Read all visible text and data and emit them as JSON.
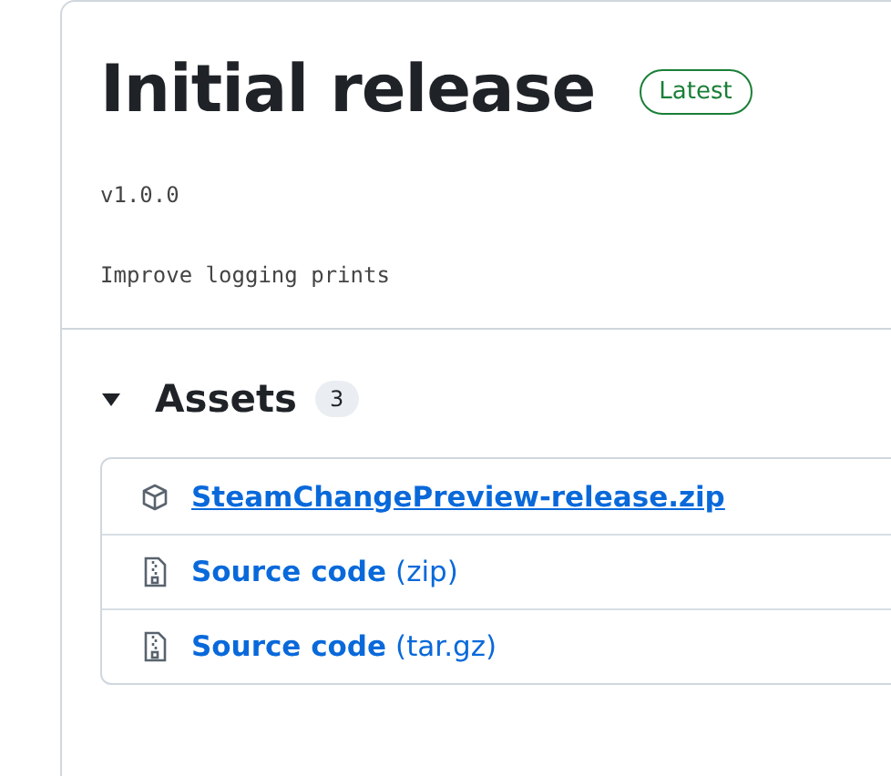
{
  "release": {
    "title": "Initial release",
    "badge": "Latest",
    "tag": "v1.0.0",
    "notes": "Improve logging prints"
  },
  "assets": {
    "heading": "Assets",
    "count": "3",
    "expanded": true,
    "items": [
      {
        "kind": "package",
        "name": "SteamChangePreview-release.zip",
        "hovered": true
      },
      {
        "kind": "archive",
        "name": "Source code",
        "suffix": "(zip)",
        "hovered": false
      },
      {
        "kind": "archive",
        "name": "Source code",
        "suffix": "(tar.gz)",
        "hovered": false
      }
    ]
  }
}
